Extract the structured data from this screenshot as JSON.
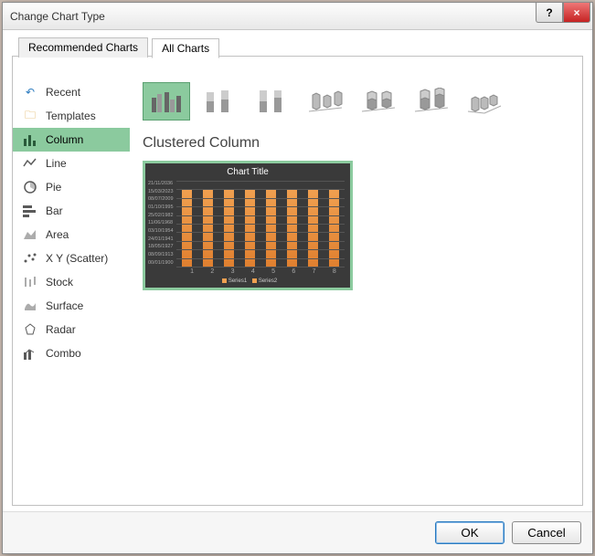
{
  "window": {
    "title": "Change Chart Type",
    "help": "?",
    "close": "×"
  },
  "tabs": [
    {
      "label": "Recommended Charts",
      "active": false
    },
    {
      "label": "All Charts",
      "active": true
    }
  ],
  "sidebar": {
    "items": [
      {
        "id": "recent",
        "label": "Recent"
      },
      {
        "id": "templates",
        "label": "Templates"
      },
      {
        "id": "column",
        "label": "Column",
        "selected": true
      },
      {
        "id": "line",
        "label": "Line"
      },
      {
        "id": "pie",
        "label": "Pie"
      },
      {
        "id": "bar",
        "label": "Bar"
      },
      {
        "id": "area",
        "label": "Area"
      },
      {
        "id": "xy",
        "label": "X Y (Scatter)"
      },
      {
        "id": "stock",
        "label": "Stock"
      },
      {
        "id": "surface",
        "label": "Surface"
      },
      {
        "id": "radar",
        "label": "Radar"
      },
      {
        "id": "combo",
        "label": "Combo"
      }
    ]
  },
  "subtypes": [
    {
      "id": "clustered-column",
      "selected": true
    },
    {
      "id": "stacked-column"
    },
    {
      "id": "100-stacked-column"
    },
    {
      "id": "3d-clustered-column"
    },
    {
      "id": "3d-stacked-column"
    },
    {
      "id": "3d-100-stacked-column"
    },
    {
      "id": "3d-column"
    }
  ],
  "section_title": "Clustered Column",
  "chart_data": {
    "type": "bar",
    "title": "Chart Title",
    "categories": [
      "1",
      "2",
      "3",
      "4",
      "5",
      "6",
      "7",
      "8"
    ],
    "series": [
      {
        "name": "Series1",
        "values": [
          90,
          90,
          90,
          90,
          90,
          90,
          90,
          90
        ]
      },
      {
        "name": "Series2",
        "values": [
          90,
          90,
          90,
          90,
          90,
          90,
          90,
          90
        ]
      }
    ],
    "yticks": [
      "21/11/2036",
      "15/03/2023",
      "08/07/2009",
      "01/10/1995",
      "25/02/1982",
      "11/06/1968",
      "03/10/1954",
      "24/01/1941",
      "18/05/1927",
      "08/09/1913",
      "00/01/1900"
    ],
    "ylim": [
      0,
      100
    ]
  },
  "footer": {
    "ok": "OK",
    "cancel": "Cancel"
  }
}
